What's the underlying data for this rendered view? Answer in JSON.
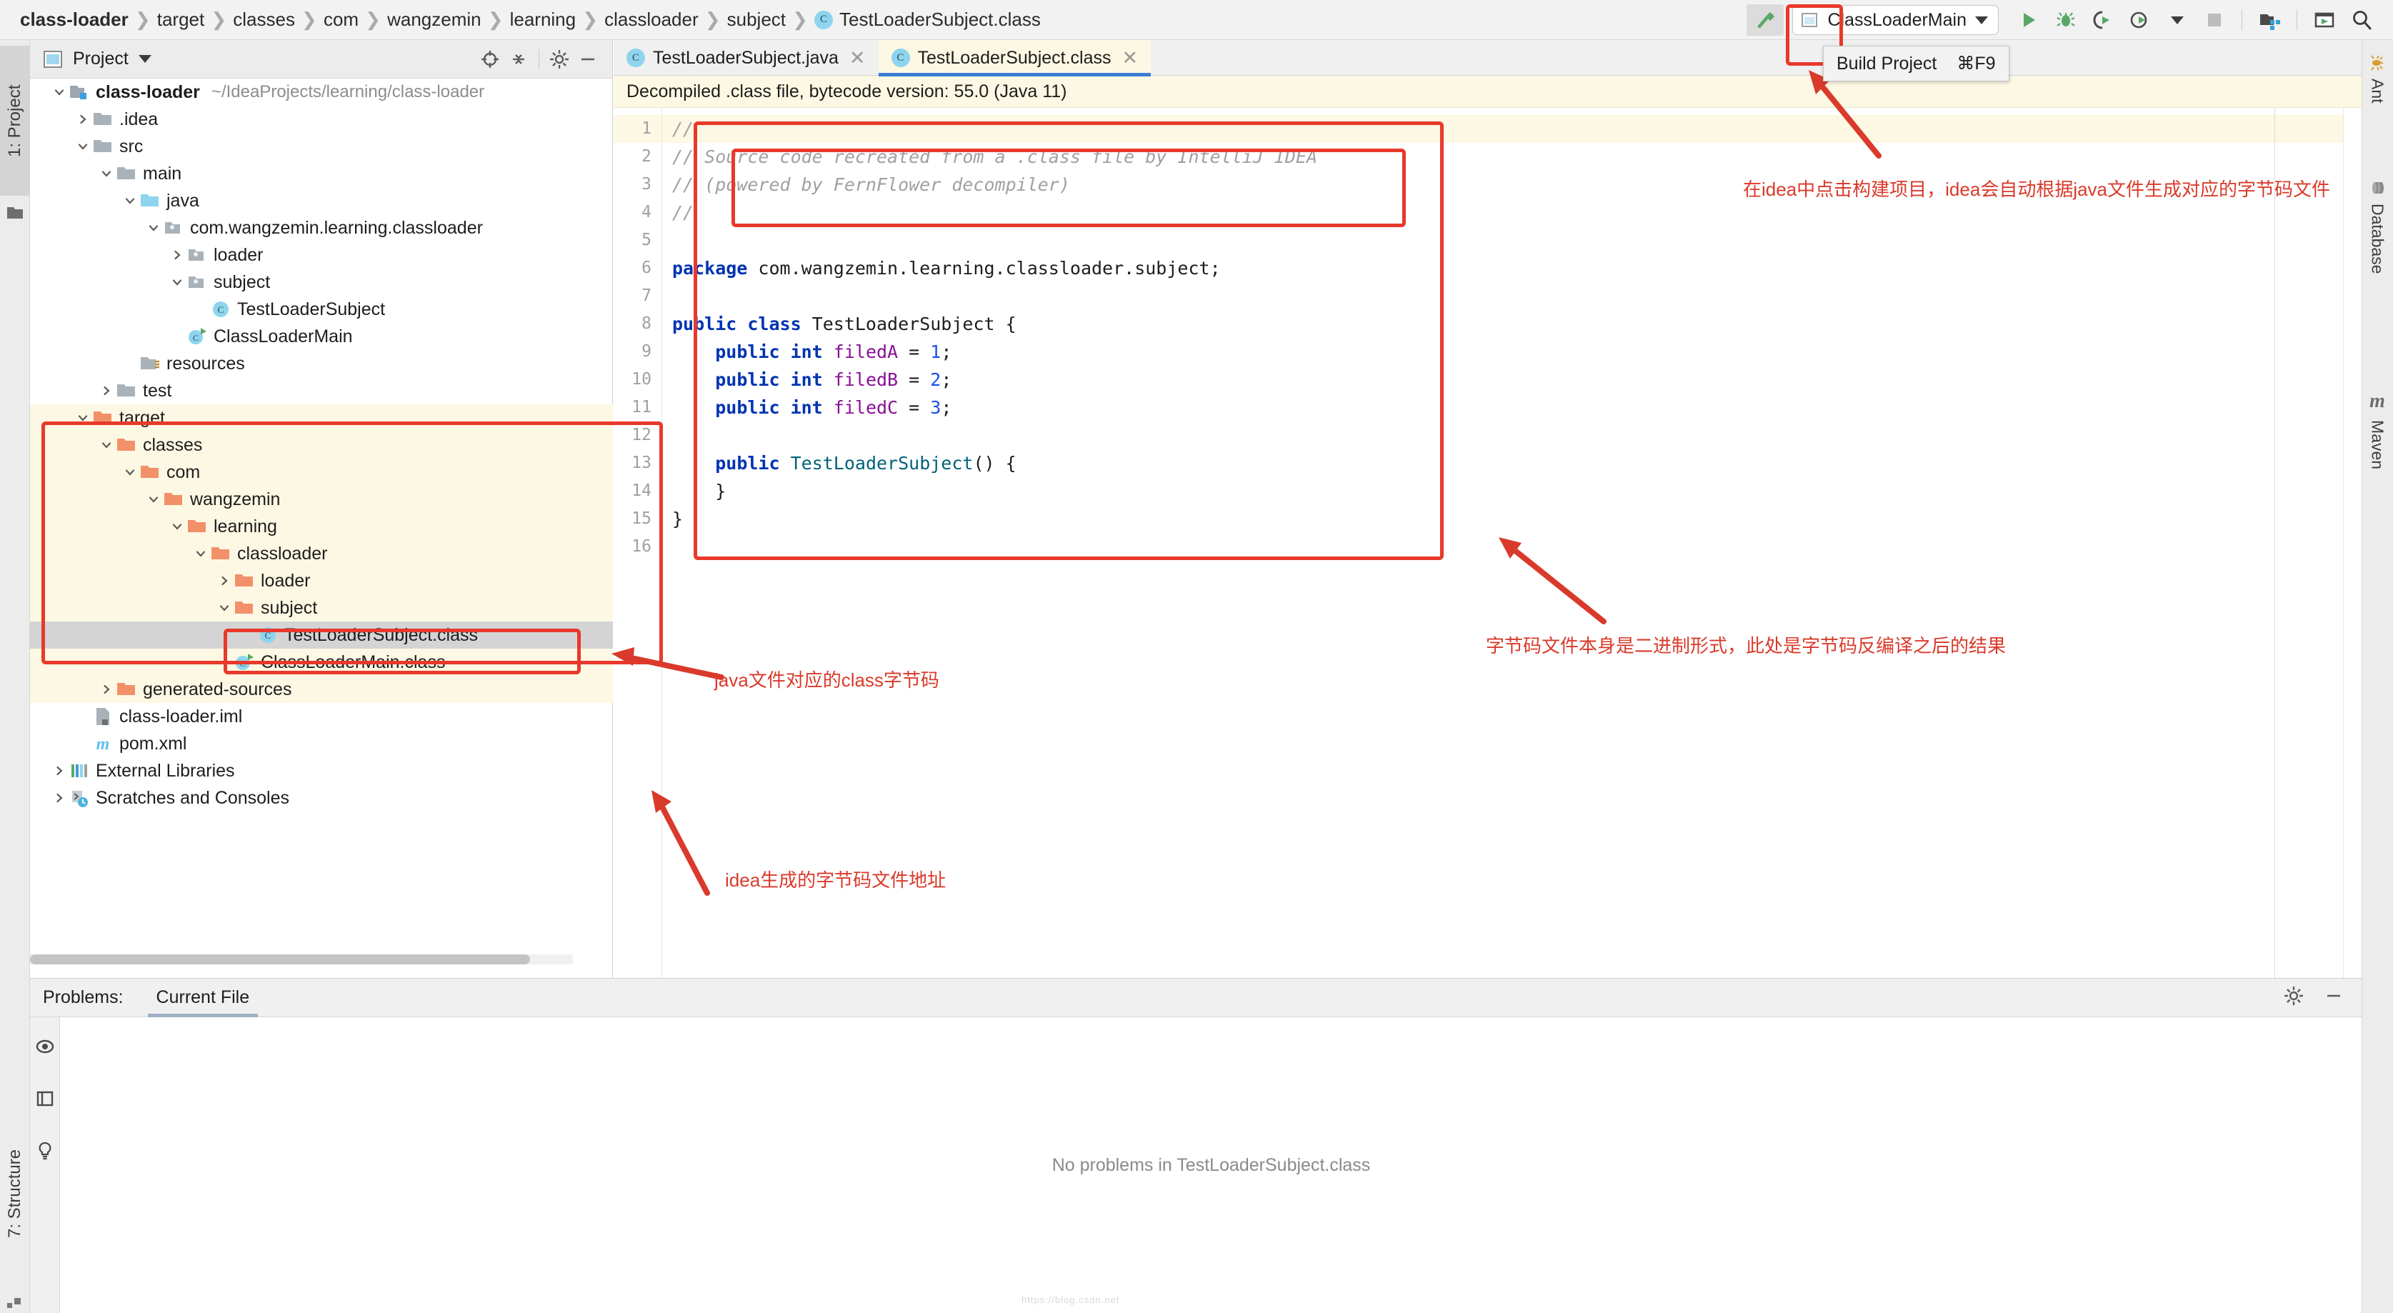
{
  "breadcrumb": {
    "items": [
      {
        "label": "class-loader",
        "bold": true
      },
      {
        "label": "target",
        "bold": false
      },
      {
        "label": "classes",
        "bold": false
      },
      {
        "label": "com",
        "bold": false
      },
      {
        "label": "wangzemin",
        "bold": false
      },
      {
        "label": "learning",
        "bold": false
      },
      {
        "label": "classloader",
        "bold": false
      },
      {
        "label": "subject",
        "bold": false
      }
    ],
    "file": "TestLoaderSubject.class",
    "separator": "❯"
  },
  "toolbar": {
    "build_icon": "hammer-icon",
    "run_config": "ClassLoaderMain",
    "icons": [
      "run-icon",
      "debug-icon",
      "run-with-coverage-icon",
      "profiler-icon",
      "stop-icon",
      "project-structure-icon",
      "open-tool-window-icon",
      "search-everywhere-icon"
    ]
  },
  "tooltip": {
    "label": "Build Project",
    "shortcut": "⌘F9"
  },
  "left_strip": {
    "project_tab": "1: Project",
    "structure_tab": "7: Structure"
  },
  "right_strip": {
    "tabs": [
      "Ant",
      "Database",
      "Maven"
    ]
  },
  "project_panel": {
    "title": "Project",
    "header_icons": [
      "locate-icon",
      "collapse-all-icon",
      "gear-icon",
      "hide-icon"
    ],
    "tree": [
      {
        "indent": 0,
        "arrow": "down",
        "icon": "module-folder-icon",
        "label": "class-loader",
        "bold": true,
        "path": "~/IdeaProjects/learning/class-loader",
        "bg": "none"
      },
      {
        "indent": 1,
        "arrow": "right",
        "icon": "folder-icon",
        "label": ".idea",
        "bold": false,
        "path": "",
        "bg": "none"
      },
      {
        "indent": 1,
        "arrow": "down",
        "icon": "folder-icon",
        "label": "src",
        "bold": false,
        "path": "",
        "bg": "none"
      },
      {
        "indent": 2,
        "arrow": "down",
        "icon": "folder-icon",
        "label": "main",
        "bold": false,
        "path": "",
        "bg": "none"
      },
      {
        "indent": 3,
        "arrow": "down",
        "icon": "source-folder-icon",
        "label": "java",
        "bold": false,
        "path": "",
        "bg": "none"
      },
      {
        "indent": 4,
        "arrow": "down",
        "icon": "package-icon",
        "label": "com.wangzemin.learning.classloader",
        "bold": false,
        "path": "",
        "bg": "none"
      },
      {
        "indent": 5,
        "arrow": "right",
        "icon": "package-icon",
        "label": "loader",
        "bold": false,
        "path": "",
        "bg": "none"
      },
      {
        "indent": 5,
        "arrow": "down",
        "icon": "package-icon",
        "label": "subject",
        "bold": false,
        "path": "",
        "bg": "none"
      },
      {
        "indent": 6,
        "arrow": "none",
        "icon": "class-icon",
        "label": "TestLoaderSubject",
        "bold": false,
        "path": "",
        "bg": "none"
      },
      {
        "indent": 5,
        "arrow": "none",
        "icon": "class-run-icon",
        "label": "ClassLoaderMain",
        "bold": false,
        "path": "",
        "bg": "none"
      },
      {
        "indent": 3,
        "arrow": "none",
        "icon": "resources-folder-icon",
        "label": "resources",
        "bold": false,
        "path": "",
        "bg": "none"
      },
      {
        "indent": 2,
        "arrow": "right",
        "icon": "folder-icon",
        "label": "test",
        "bold": false,
        "path": "",
        "bg": "none"
      },
      {
        "indent": 1,
        "arrow": "down",
        "icon": "excluded-folder-icon",
        "label": "target",
        "bold": false,
        "path": "",
        "bg": "yellow"
      },
      {
        "indent": 2,
        "arrow": "down",
        "icon": "excluded-folder-icon",
        "label": "classes",
        "bold": false,
        "path": "",
        "bg": "yellow"
      },
      {
        "indent": 3,
        "arrow": "down",
        "icon": "excluded-folder-icon",
        "label": "com",
        "bold": false,
        "path": "",
        "bg": "yellow"
      },
      {
        "indent": 4,
        "arrow": "down",
        "icon": "excluded-folder-icon",
        "label": "wangzemin",
        "bold": false,
        "path": "",
        "bg": "yellow"
      },
      {
        "indent": 5,
        "arrow": "down",
        "icon": "excluded-folder-icon",
        "label": "learning",
        "bold": false,
        "path": "",
        "bg": "yellow"
      },
      {
        "indent": 6,
        "arrow": "down",
        "icon": "excluded-folder-icon",
        "label": "classloader",
        "bold": false,
        "path": "",
        "bg": "yellow"
      },
      {
        "indent": 7,
        "arrow": "right",
        "icon": "excluded-folder-icon",
        "label": "loader",
        "bold": false,
        "path": "",
        "bg": "yellow"
      },
      {
        "indent": 7,
        "arrow": "down",
        "icon": "excluded-folder-icon",
        "label": "subject",
        "bold": false,
        "path": "",
        "bg": "yellow"
      },
      {
        "indent": 8,
        "arrow": "none",
        "icon": "class-icon",
        "label": "TestLoaderSubject.class",
        "bold": false,
        "path": "",
        "bg": "selected"
      },
      {
        "indent": 7,
        "arrow": "none",
        "icon": "class-run-icon",
        "label": "ClassLoaderMain.class",
        "bold": false,
        "path": "",
        "bg": "yellow"
      },
      {
        "indent": 2,
        "arrow": "right",
        "icon": "excluded-folder-icon",
        "label": "generated-sources",
        "bold": false,
        "path": "",
        "bg": "yellow"
      },
      {
        "indent": 1,
        "arrow": "none",
        "icon": "iml-file-icon",
        "label": "class-loader.iml",
        "bold": false,
        "path": "",
        "bg": "none"
      },
      {
        "indent": 1,
        "arrow": "none",
        "icon": "maven-file-icon",
        "label": "pom.xml",
        "bold": false,
        "path": "",
        "bg": "none"
      },
      {
        "indent": 0,
        "arrow": "right",
        "icon": "libraries-icon",
        "label": "External Libraries",
        "bold": false,
        "path": "",
        "bg": "none"
      },
      {
        "indent": 0,
        "arrow": "right",
        "icon": "scratches-icon",
        "label": "Scratches and Consoles",
        "bold": false,
        "path": "",
        "bg": "none"
      }
    ]
  },
  "editor": {
    "tabs": [
      {
        "label": "TestLoaderSubject.java",
        "icon": "class-icon",
        "active": false
      },
      {
        "label": "TestLoaderSubject.class",
        "icon": "class-icon",
        "active": true
      }
    ],
    "notice": "Decompiled .class file, bytecode version: 55.0 (Java 11)",
    "line_numbers": [
      "1",
      "2",
      "3",
      "4",
      "5",
      "6",
      "7",
      "8",
      "9",
      "10",
      "11",
      "12",
      "13",
      "14",
      "15",
      "16"
    ],
    "code": [
      {
        "n": 1,
        "segments": [
          {
            "t": "//",
            "c": "cmt"
          }
        ],
        "hl": true
      },
      {
        "n": 2,
        "segments": [
          {
            "t": "// Source code recreated from a .class file by IntelliJ IDEA",
            "c": "cmt"
          }
        ],
        "hl": false
      },
      {
        "n": 3,
        "segments": [
          {
            "t": "// (powered by FernFlower decompiler)",
            "c": "cmt"
          }
        ],
        "hl": false
      },
      {
        "n": 4,
        "segments": [
          {
            "t": "//",
            "c": "cmt"
          }
        ],
        "hl": false
      },
      {
        "n": 5,
        "segments": [],
        "hl": false
      },
      {
        "n": 6,
        "segments": [
          {
            "t": "package",
            "c": "kw"
          },
          {
            "t": " com.wangzemin.learning.classloader.subject;",
            "c": "plain"
          }
        ],
        "hl": false
      },
      {
        "n": 7,
        "segments": [],
        "hl": false
      },
      {
        "n": 8,
        "segments": [
          {
            "t": "public class",
            "c": "kw"
          },
          {
            "t": " TestLoaderSubject {",
            "c": "plain"
          }
        ],
        "hl": false
      },
      {
        "n": 9,
        "segments": [
          {
            "t": "    ",
            "c": "plain"
          },
          {
            "t": "public int",
            "c": "kw"
          },
          {
            "t": " ",
            "c": "plain"
          },
          {
            "t": "filedA",
            "c": "fld"
          },
          {
            "t": " = ",
            "c": "plain"
          },
          {
            "t": "1",
            "c": "num"
          },
          {
            "t": ";",
            "c": "plain"
          }
        ],
        "hl": false
      },
      {
        "n": 10,
        "segments": [
          {
            "t": "    ",
            "c": "plain"
          },
          {
            "t": "public int",
            "c": "kw"
          },
          {
            "t": " ",
            "c": "plain"
          },
          {
            "t": "filedB",
            "c": "fld"
          },
          {
            "t": " = ",
            "c": "plain"
          },
          {
            "t": "2",
            "c": "num"
          },
          {
            "t": ";",
            "c": "plain"
          }
        ],
        "hl": false
      },
      {
        "n": 11,
        "segments": [
          {
            "t": "    ",
            "c": "plain"
          },
          {
            "t": "public int",
            "c": "kw"
          },
          {
            "t": " ",
            "c": "plain"
          },
          {
            "t": "filedC",
            "c": "fld"
          },
          {
            "t": " = ",
            "c": "plain"
          },
          {
            "t": "3",
            "c": "num"
          },
          {
            "t": ";",
            "c": "plain"
          }
        ],
        "hl": false
      },
      {
        "n": 12,
        "segments": [],
        "hl": false
      },
      {
        "n": 13,
        "segments": [
          {
            "t": "    ",
            "c": "plain"
          },
          {
            "t": "public",
            "c": "kw"
          },
          {
            "t": " ",
            "c": "plain"
          },
          {
            "t": "TestLoaderSubject",
            "c": "ctor"
          },
          {
            "t": "() {",
            "c": "plain"
          }
        ],
        "hl": false
      },
      {
        "n": 14,
        "segments": [
          {
            "t": "    }",
            "c": "plain"
          }
        ],
        "hl": false
      },
      {
        "n": 15,
        "segments": [
          {
            "t": "}",
            "c": "plain"
          }
        ],
        "hl": false
      },
      {
        "n": 16,
        "segments": [],
        "hl": false
      }
    ]
  },
  "problems_panel": {
    "title": "Problems:",
    "tab": "Current File",
    "empty_message": "No problems in TestLoaderSubject.class",
    "side_icons": [
      "eye-icon",
      "preview-icon",
      "bulb-icon"
    ],
    "header_icons": [
      "gear-icon",
      "minimize-icon"
    ]
  },
  "annotations": {
    "color": "#d93a2b",
    "texts": [
      {
        "id": "build-note",
        "text": "在idea中点击构建项目，idea会自动根据java文件生成对应的字节码文件"
      },
      {
        "id": "decompile-note",
        "text": "字节码文件本身是二进制形式，此处是字节码反编译之后的结果"
      },
      {
        "id": "classfile-note",
        "text": "java文件对应的class字节码"
      },
      {
        "id": "path-note",
        "text": "idea生成的字节码文件地址"
      }
    ]
  },
  "watermark": "https://blog.csdn.net"
}
